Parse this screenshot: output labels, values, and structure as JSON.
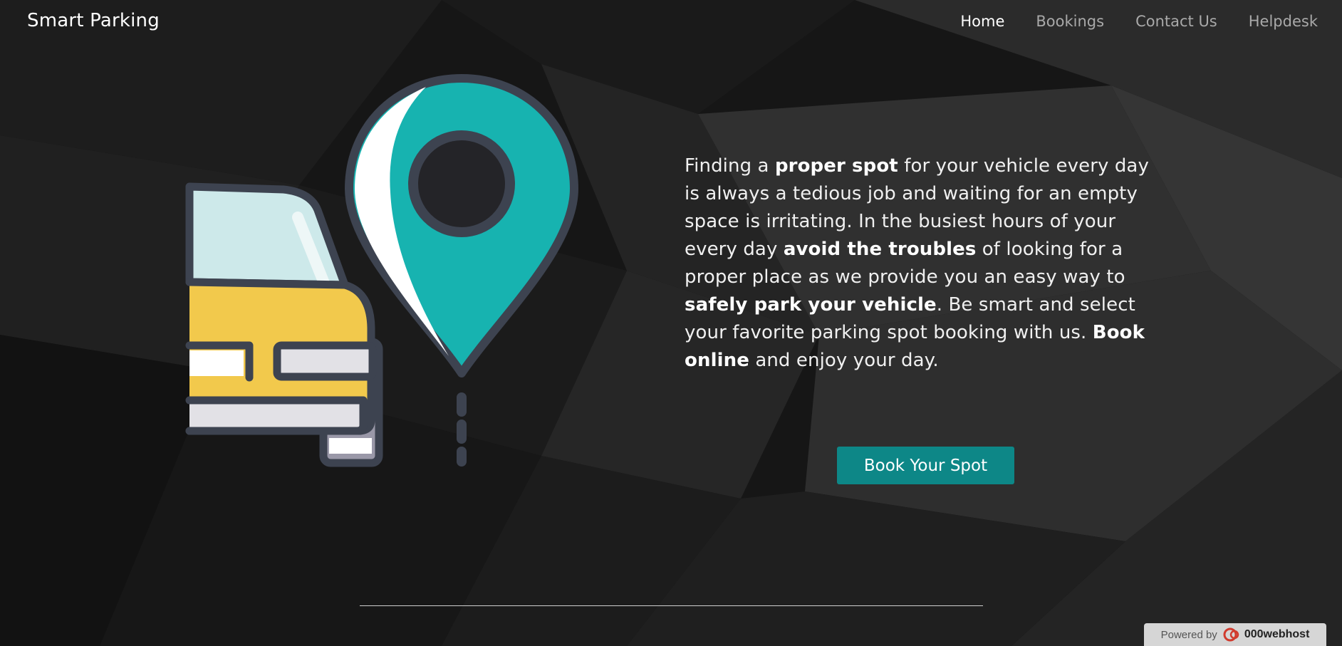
{
  "header": {
    "brand": "Smart Parking",
    "nav": [
      {
        "label": "Home",
        "active": true
      },
      {
        "label": "Bookings",
        "active": false
      },
      {
        "label": "Contact Us",
        "active": false
      },
      {
        "label": "Helpdesk",
        "active": false
      }
    ]
  },
  "hero": {
    "illustration_icons": [
      "car-icon",
      "map-pin-icon"
    ],
    "intro": [
      {
        "text": "Finding a ",
        "bold": false
      },
      {
        "text": "proper spot",
        "bold": true
      },
      {
        "text": " for your vehicle every day is always a tedious job and waiting for an empty space is irritating. In the busiest hours of your every day ",
        "bold": false
      },
      {
        "text": "avoid the troubles",
        "bold": true
      },
      {
        "text": " of looking for a proper place as we provide you an easy way to ",
        "bold": false
      },
      {
        "text": "safely park your vehicle",
        "bold": true
      },
      {
        "text": ". Be smart and select your favorite parking spot booking with us. ",
        "bold": false
      },
      {
        "text": "Book online",
        "bold": true
      },
      {
        "text": " and enjoy your day.",
        "bold": false
      }
    ],
    "cta_label": "Book Your Spot"
  },
  "footer": {
    "badge_prefix": "Powered by",
    "badge_host": "000webhost"
  },
  "colors": {
    "accent": "#0d8787",
    "pin": "#17b3b0",
    "car_body": "#f2c94c",
    "windshield": "#cde9ea",
    "outline": "#3d4350"
  }
}
